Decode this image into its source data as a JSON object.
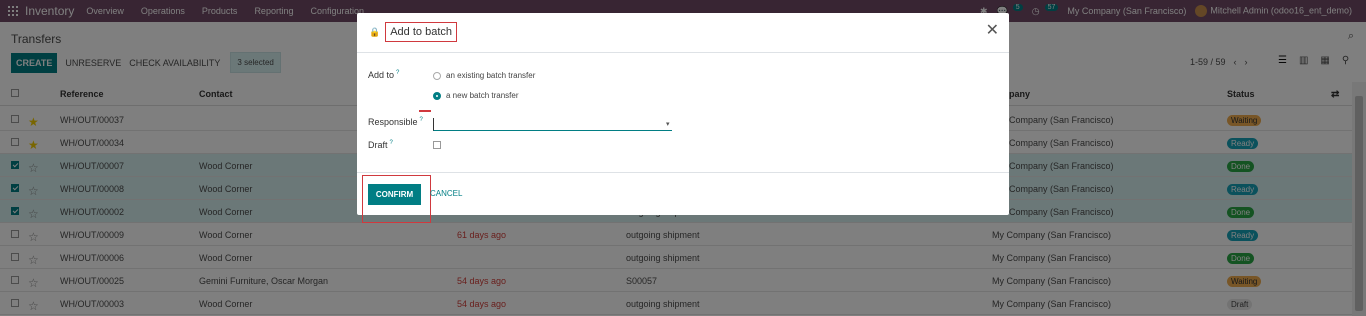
{
  "topnav": {
    "app_name": "Inventory",
    "menu": [
      "Overview",
      "Operations",
      "Products",
      "Reporting",
      "Configuration"
    ],
    "chat_count": "5",
    "activity_count": "57",
    "company": "My Company (San Francisco)",
    "user": "Mitchell Admin (odoo16_ent_demo)"
  },
  "control": {
    "breadcrumb": "Transfers",
    "create_label": "CREATE",
    "unreserve_label": "UNRESERVE",
    "check_availability_label": "CHECK AVAILABILITY",
    "selected_label": "3 selected",
    "pager": "1-59 / 59"
  },
  "table": {
    "headers": {
      "reference": "Reference",
      "contact": "Contact",
      "company": "Company",
      "status": "Status"
    },
    "company_header_visible": "pany",
    "rows": [
      {
        "reference": "WH/OUT/00037",
        "contact": "",
        "scheduled": "",
        "source": "",
        "company": "Company (San Francisco)",
        "status": "Waiting",
        "status_class": "st-waiting",
        "selected": false,
        "fav": true
      },
      {
        "reference": "WH/OUT/00034",
        "contact": "",
        "scheduled": "",
        "source": "",
        "company": "Company (San Francisco)",
        "status": "Ready",
        "status_class": "st-ready",
        "selected": false,
        "fav": true
      },
      {
        "reference": "WH/OUT/00007",
        "contact": "Wood Corner",
        "scheduled": "",
        "source": "",
        "company": "Company (San Francisco)",
        "status": "Done",
        "status_class": "st-done",
        "selected": true,
        "fav": false
      },
      {
        "reference": "WH/OUT/00008",
        "contact": "Wood Corner",
        "scheduled": "",
        "source": "",
        "company": "Company (San Francisco)",
        "status": "Ready",
        "status_class": "st-ready",
        "selected": true,
        "fav": false
      },
      {
        "reference": "WH/OUT/00002",
        "contact": "Wood Corner",
        "scheduled": "",
        "source": "outgoing shipment",
        "company": "Company (San Francisco)",
        "status": "Done",
        "status_class": "st-done",
        "selected": true,
        "fav": false
      },
      {
        "reference": "WH/OUT/00009",
        "contact": "Wood Corner",
        "scheduled": "61 days ago",
        "source": "outgoing shipment",
        "company": "My Company (San Francisco)",
        "status": "Ready",
        "status_class": "st-ready",
        "selected": false,
        "fav": false
      },
      {
        "reference": "WH/OUT/00006",
        "contact": "Wood Corner",
        "scheduled": "",
        "source": "outgoing shipment",
        "company": "My Company (San Francisco)",
        "status": "Done",
        "status_class": "st-done",
        "selected": false,
        "fav": false
      },
      {
        "reference": "WH/OUT/00025",
        "contact": "Gemini Furniture, Oscar Morgan",
        "scheduled": "54 days ago",
        "source": "S00057",
        "company": "My Company (San Francisco)",
        "status": "Waiting",
        "status_class": "st-waiting",
        "selected": false,
        "fav": false
      },
      {
        "reference": "WH/OUT/00003",
        "contact": "Wood Corner",
        "scheduled": "54 days ago",
        "source": "outgoing shipment",
        "company": "My Company (San Francisco)",
        "status": "Draft",
        "status_class": "st-draft",
        "selected": false,
        "fav": false
      }
    ]
  },
  "modal": {
    "title": "Add to batch",
    "add_to_label": "Add to",
    "option_existing": "an existing batch transfer",
    "option_new": "a new batch transfer",
    "responsible_label": "Responsible",
    "responsible_value": "",
    "draft_label": "Draft",
    "help_mark": "?",
    "confirm_label": "CONFIRM",
    "cancel_label": "CANCEL"
  }
}
